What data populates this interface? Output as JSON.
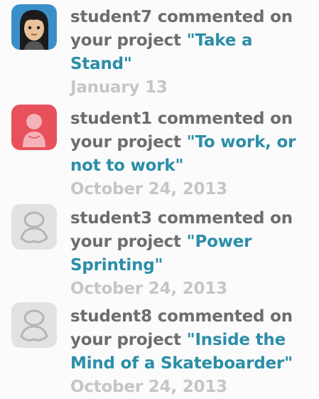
{
  "activity_feed": {
    "items": [
      {
        "user": "student7",
        "action": "commented on your project",
        "project_title": "\"Take a Stand\"",
        "date": "January 13",
        "avatar_icon": "girl-avatar-icon"
      },
      {
        "user": "student1",
        "action": "commented on your project",
        "project_title": "\"To work, or not to work\"",
        "date": "October 24, 2013",
        "avatar_icon": "red-person-avatar-icon"
      },
      {
        "user": "student3",
        "action": "commented on your project",
        "project_title": "\"Power Sprinting\"",
        "date": "October 24, 2013",
        "avatar_icon": "default-person-avatar-icon"
      },
      {
        "user": "student8",
        "action": "commented on your project",
        "project_title": "\"Inside the Mind of a Skateboarder\"",
        "date": "October 24, 2013",
        "avatar_icon": "default-person-avatar-icon"
      }
    ],
    "colors": {
      "text": "#6d6d6d",
      "link": "#2c8ea8",
      "date": "#c6c6c6",
      "avatar_red": "#e8505b",
      "avatar_gray": "#d4d4d4"
    }
  }
}
